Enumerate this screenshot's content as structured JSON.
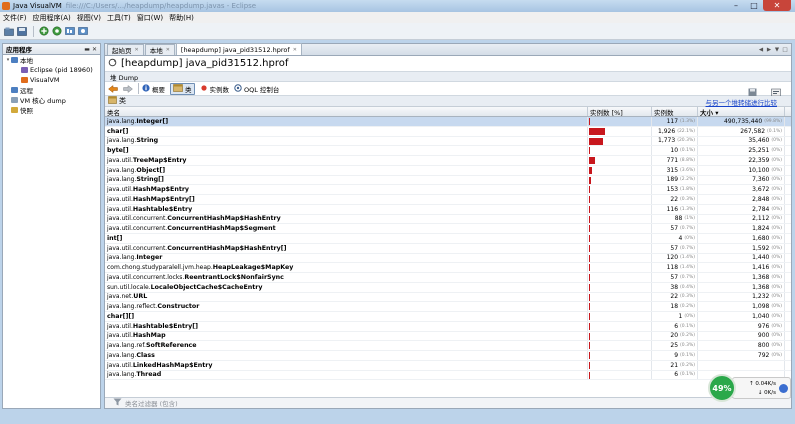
{
  "window": {
    "title": "Java VisualVM",
    "title_extra": "file:///C:/Users/.../heapdump/heapdump.javas - Eclipse"
  },
  "menu": [
    "文件(F)",
    "应用程序(A)",
    "视图(V)",
    "工具(T)",
    "窗口(W)",
    "帮助(H)"
  ],
  "left_panel": {
    "title": "应用程序",
    "tree": [
      {
        "label": "本地",
        "level": 0,
        "twisty": "▾",
        "icon_color": "#4d7fc1",
        "icon": "computer-icon"
      },
      {
        "label": "Eclipse (pid 18960)",
        "level": 1,
        "twisty": "",
        "icon_color": "#7a5fb5",
        "icon": "eclipse-icon"
      },
      {
        "label": "VisualVM",
        "level": 1,
        "twisty": "",
        "icon_color": "#e06c1c",
        "icon": "visualvm-icon"
      },
      {
        "label": "远程",
        "level": 0,
        "twisty": "",
        "icon_color": "#4d7fc1",
        "icon": "remote-icon"
      },
      {
        "label": "VM 核心 dump",
        "level": 0,
        "twisty": "",
        "icon_color": "#8aa0b8",
        "icon": "core-dump-icon"
      },
      {
        "label": "快照",
        "level": 0,
        "twisty": "",
        "icon_color": "#d2a93b",
        "icon": "snapshot-icon"
      }
    ]
  },
  "tabs": [
    {
      "label": "起始页",
      "active": false
    },
    {
      "label": "本地",
      "active": false
    },
    {
      "label": "[heapdump] java_pid31512.hprof",
      "active": true
    }
  ],
  "doc": {
    "title": "[heapdump] java_pid31512.hprof",
    "sub_label": "堆 Dump"
  },
  "views": [
    {
      "label": "概要",
      "icon": "info-icon",
      "selected": false
    },
    {
      "label": "类",
      "icon": "classes-icon",
      "selected": true
    },
    {
      "label": "实例数",
      "icon": "instances-icon",
      "selected": false
    },
    {
      "label": "OQL 控制台",
      "icon": "oql-icon",
      "selected": false
    }
  ],
  "class_bar": {
    "label": "类",
    "compare_link": "与另一个堆转储进行比较"
  },
  "table": {
    "columns": [
      "类名",
      "实例数 [%]",
      "实例数",
      "大小 ▾"
    ],
    "rows": [
      {
        "pkg": "java.lang.",
        "cls": "Integer[]",
        "pct": 5.4,
        "count": "117",
        "count_pct": "(1.3%)",
        "size": "490,735,440",
        "size_pct": "(99.8%)"
      },
      {
        "pkg": "",
        "cls": "char[]",
        "pct": 89.1,
        "count": "1,926",
        "count_pct": "(22.1%)",
        "size": "267,582",
        "size_pct": "(0.1%)"
      },
      {
        "pkg": "java.lang.",
        "cls": "String",
        "pct": 80.2,
        "count": "1,773",
        "count_pct": "(20.3%)",
        "size": "35,460",
        "size_pct": "(0%)"
      },
      {
        "pkg": "",
        "cls": "byte[]",
        "pct": 0.5,
        "count": "10",
        "count_pct": "(0.1%)",
        "size": "25,251",
        "size_pct": "(0%)"
      },
      {
        "pkg": "java.util.",
        "cls": "TreeMap$Entry",
        "pct": 34.9,
        "count": "771",
        "count_pct": "(8.8%)",
        "size": "22,359",
        "size_pct": "(0%)"
      },
      {
        "pkg": "java.lang.",
        "cls": "Object[]",
        "pct": 14.2,
        "count": "315",
        "count_pct": "(3.6%)",
        "size": "10,100",
        "size_pct": "(0%)"
      },
      {
        "pkg": "java.lang.",
        "cls": "String[]",
        "pct": 8.5,
        "count": "189",
        "count_pct": "(2.2%)",
        "size": "7,360",
        "size_pct": "(0%)"
      },
      {
        "pkg": "java.util.",
        "cls": "HashMap$Entry",
        "pct": 6.9,
        "count": "153",
        "count_pct": "(1.8%)",
        "size": "3,672",
        "size_pct": "(0%)"
      },
      {
        "pkg": "java.util.",
        "cls": "HashMap$Entry[]",
        "pct": 1.0,
        "count": "22",
        "count_pct": "(0.3%)",
        "size": "2,848",
        "size_pct": "(0%)"
      },
      {
        "pkg": "java.util.",
        "cls": "Hashtable$Entry",
        "pct": 5.2,
        "count": "116",
        "count_pct": "(1.3%)",
        "size": "2,784",
        "size_pct": "(0%)"
      },
      {
        "pkg": "java.util.concurrent.",
        "cls": "ConcurrentHashMap$HashEntry",
        "pct": 4.0,
        "count": "88",
        "count_pct": "(1%)",
        "size": "2,112",
        "size_pct": "(0%)"
      },
      {
        "pkg": "java.util.concurrent.",
        "cls": "ConcurrentHashMap$Segment",
        "pct": 2.6,
        "count": "57",
        "count_pct": "(0.7%)",
        "size": "1,824",
        "size_pct": "(0%)"
      },
      {
        "pkg": "",
        "cls": "int[]",
        "pct": 0.2,
        "count": "4",
        "count_pct": "(0%)",
        "size": "1,680",
        "size_pct": "(0%)"
      },
      {
        "pkg": "java.util.concurrent.",
        "cls": "ConcurrentHashMap$HashEntry[]",
        "pct": 2.6,
        "count": "57",
        "count_pct": "(0.7%)",
        "size": "1,592",
        "size_pct": "(0%)"
      },
      {
        "pkg": "java.lang.",
        "cls": "Integer",
        "pct": 5.4,
        "count": "120",
        "count_pct": "(1.4%)",
        "size": "1,440",
        "size_pct": "(0%)"
      },
      {
        "pkg": "com.chong.studyparalell.jvm.heap.",
        "cls": "HeapLeakage$MapKey",
        "pct": 5.3,
        "count": "118",
        "count_pct": "(1.4%)",
        "size": "1,416",
        "size_pct": "(0%)"
      },
      {
        "pkg": "java.util.concurrent.locks.",
        "cls": "ReentrantLock$NonfairSync",
        "pct": 2.6,
        "count": "57",
        "count_pct": "(0.7%)",
        "size": "1,368",
        "size_pct": "(0%)"
      },
      {
        "pkg": "sun.util.locale.",
        "cls": "LocaleObjectCache$CacheEntry",
        "pct": 1.7,
        "count": "38",
        "count_pct": "(0.4%)",
        "size": "1,368",
        "size_pct": "(0%)"
      },
      {
        "pkg": "java.net.",
        "cls": "URL",
        "pct": 1.0,
        "count": "22",
        "count_pct": "(0.3%)",
        "size": "1,232",
        "size_pct": "(0%)"
      },
      {
        "pkg": "java.lang.reflect.",
        "cls": "Constructor",
        "pct": 0.8,
        "count": "18",
        "count_pct": "(0.2%)",
        "size": "1,098",
        "size_pct": "(0%)"
      },
      {
        "pkg": "",
        "cls": "char[][]",
        "pct": 0.05,
        "count": "1",
        "count_pct": "(0%)",
        "size": "1,040",
        "size_pct": "(0%)"
      },
      {
        "pkg": "java.util.",
        "cls": "Hashtable$Entry[]",
        "pct": 0.3,
        "count": "6",
        "count_pct": "(0.1%)",
        "size": "976",
        "size_pct": "(0%)"
      },
      {
        "pkg": "java.util.",
        "cls": "HashMap",
        "pct": 0.9,
        "count": "20",
        "count_pct": "(0.2%)",
        "size": "900",
        "size_pct": "(0%)"
      },
      {
        "pkg": "java.lang.ref.",
        "cls": "SoftReference",
        "pct": 1.1,
        "count": "25",
        "count_pct": "(0.3%)",
        "size": "800",
        "size_pct": "(0%)"
      },
      {
        "pkg": "java.lang.",
        "cls": "Class",
        "pct": 0.4,
        "count": "9",
        "count_pct": "(0.1%)",
        "size": "792",
        "size_pct": "(0%)"
      },
      {
        "pkg": "java.util.",
        "cls": "LinkedHashMap$Entry",
        "pct": 0.9,
        "count": "21",
        "count_pct": "(0.2%)",
        "size": "",
        "size_pct": ""
      },
      {
        "pkg": "java.lang.",
        "cls": "Thread",
        "pct": 0.3,
        "count": "6",
        "count_pct": "(0.1%)",
        "size": "",
        "size_pct": ""
      }
    ]
  },
  "filter": {
    "placeholder": "类名过滤器 (包含)"
  },
  "net_widget": {
    "percent": "49%",
    "up": "0.04K/s",
    "down": "0K/s"
  },
  "colors": {
    "bar": "#c8171d",
    "selection": "#c7d9ef",
    "link": "#1742c9"
  }
}
